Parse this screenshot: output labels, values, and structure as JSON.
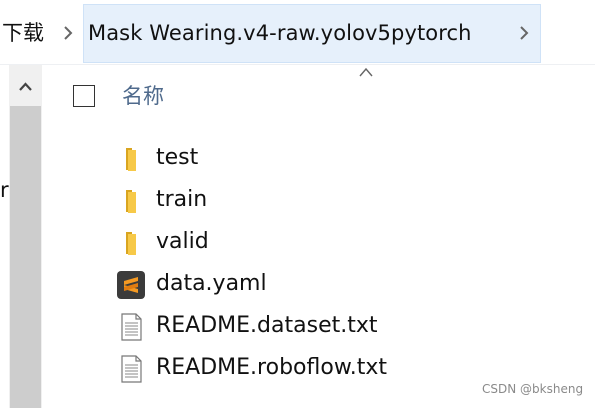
{
  "breadcrumb": {
    "root": "下载",
    "current": "Mask Wearing.v4-raw.yolov5pytorch"
  },
  "nav": {
    "partial_letter": "r"
  },
  "list": {
    "column_header": "名称",
    "items": [
      {
        "name": "test",
        "icon": "folder-icon"
      },
      {
        "name": "train",
        "icon": "folder-icon"
      },
      {
        "name": "valid",
        "icon": "folder-icon"
      },
      {
        "name": "data.yaml",
        "icon": "sublime-file-icon"
      },
      {
        "name": "README.dataset.txt",
        "icon": "text-file-icon"
      },
      {
        "name": "README.roboflow.txt",
        "icon": "text-file-icon"
      }
    ]
  },
  "watermark": "CSDN @bksheng",
  "colors": {
    "folder": "#f7c948",
    "selected_crumb": "#e6f0fb",
    "sublime_bg": "#3b3b3b",
    "sublime_accent": "#f59a23",
    "header_text": "#4f6a8c"
  }
}
